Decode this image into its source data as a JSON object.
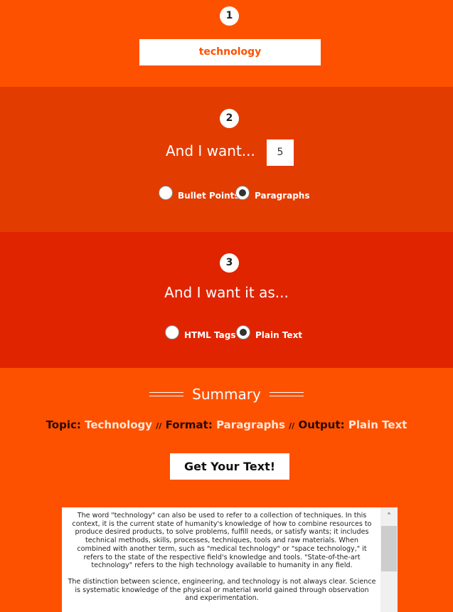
{
  "step1": {
    "number": "1",
    "topic": "technology"
  },
  "step2": {
    "number": "2",
    "label": "And I want...",
    "count": "5",
    "options": [
      {
        "label": "Bullet Points",
        "selected": false
      },
      {
        "label": "Paragraphs",
        "selected": true
      }
    ]
  },
  "step3": {
    "number": "3",
    "label": "And I want it as...",
    "options": [
      {
        "label": "HTML Tags",
        "selected": false
      },
      {
        "label": "Plain Text",
        "selected": true
      }
    ]
  },
  "summary": {
    "title": "Summary",
    "topic_key": "Topic:",
    "topic_value": "Technology",
    "sep": "//",
    "format_key": "Format:",
    "format_value": "Paragraphs",
    "output_key": "Output:",
    "output_value": "Plain Text",
    "button": "Get Your Text!"
  },
  "output": {
    "paragraphs": [
      "The word \"technology\" can also be used to refer to a collection of techniques. In this context, it is the current state of humanity's knowledge of how to combine resources to produce desired products, to solve problems, fulfill needs, or satisfy wants; it includes technical methods, skills, processes, techniques, tools and raw materials. When combined with another term, such as \"medical technology\" or \"space technology,\" it refers to the state of the respective field's knowledge and tools. \"State-of-the-art technology\" refers to the high technology available to humanity in any field.",
      "The distinction between science, engineering, and technology is not always clear. Science is systematic knowledge of the physical or material world gained through observation and experimentation."
    ]
  }
}
